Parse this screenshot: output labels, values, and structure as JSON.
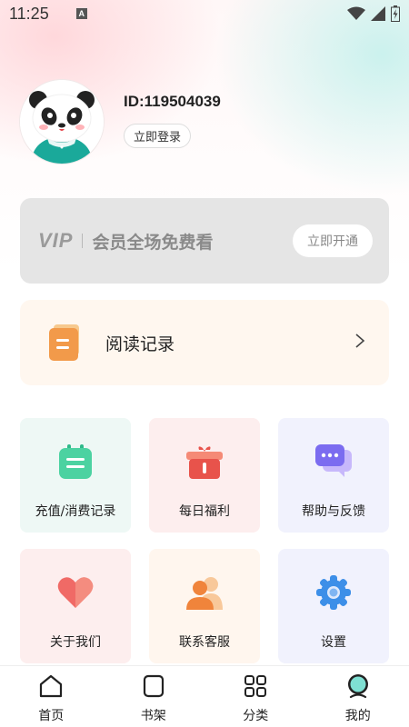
{
  "status_bar": {
    "time": "11:25",
    "badge": "A"
  },
  "profile": {
    "id_text": "ID:119504039",
    "login_label": "立即登录"
  },
  "vip": {
    "logo": "VIP",
    "tagline": "会员全场免费看",
    "button_label": "立即开通"
  },
  "history": {
    "label": "阅读记录"
  },
  "grid": {
    "items": [
      {
        "label": "充值/消费记录",
        "icon": "recharge-record-icon"
      },
      {
        "label": "每日福利",
        "icon": "gift-icon"
      },
      {
        "label": "帮助与反馈",
        "icon": "chat-bubble-icon"
      },
      {
        "label": "关于我们",
        "icon": "heart-icon"
      },
      {
        "label": "联系客服",
        "icon": "customer-service-icon"
      },
      {
        "label": "设置",
        "icon": "gear-icon"
      }
    ]
  },
  "tabbar": {
    "items": [
      {
        "label": "首页",
        "icon": "home-icon"
      },
      {
        "label": "书架",
        "icon": "bookshelf-icon"
      },
      {
        "label": "分类",
        "icon": "category-grid-icon"
      },
      {
        "label": "我的",
        "icon": "profile-icon",
        "active": true
      }
    ]
  },
  "colors": {
    "accent_teal": "#1aa99a",
    "history_orange": "#f29a4a",
    "vip_card_bg": "#e5e5e5"
  }
}
